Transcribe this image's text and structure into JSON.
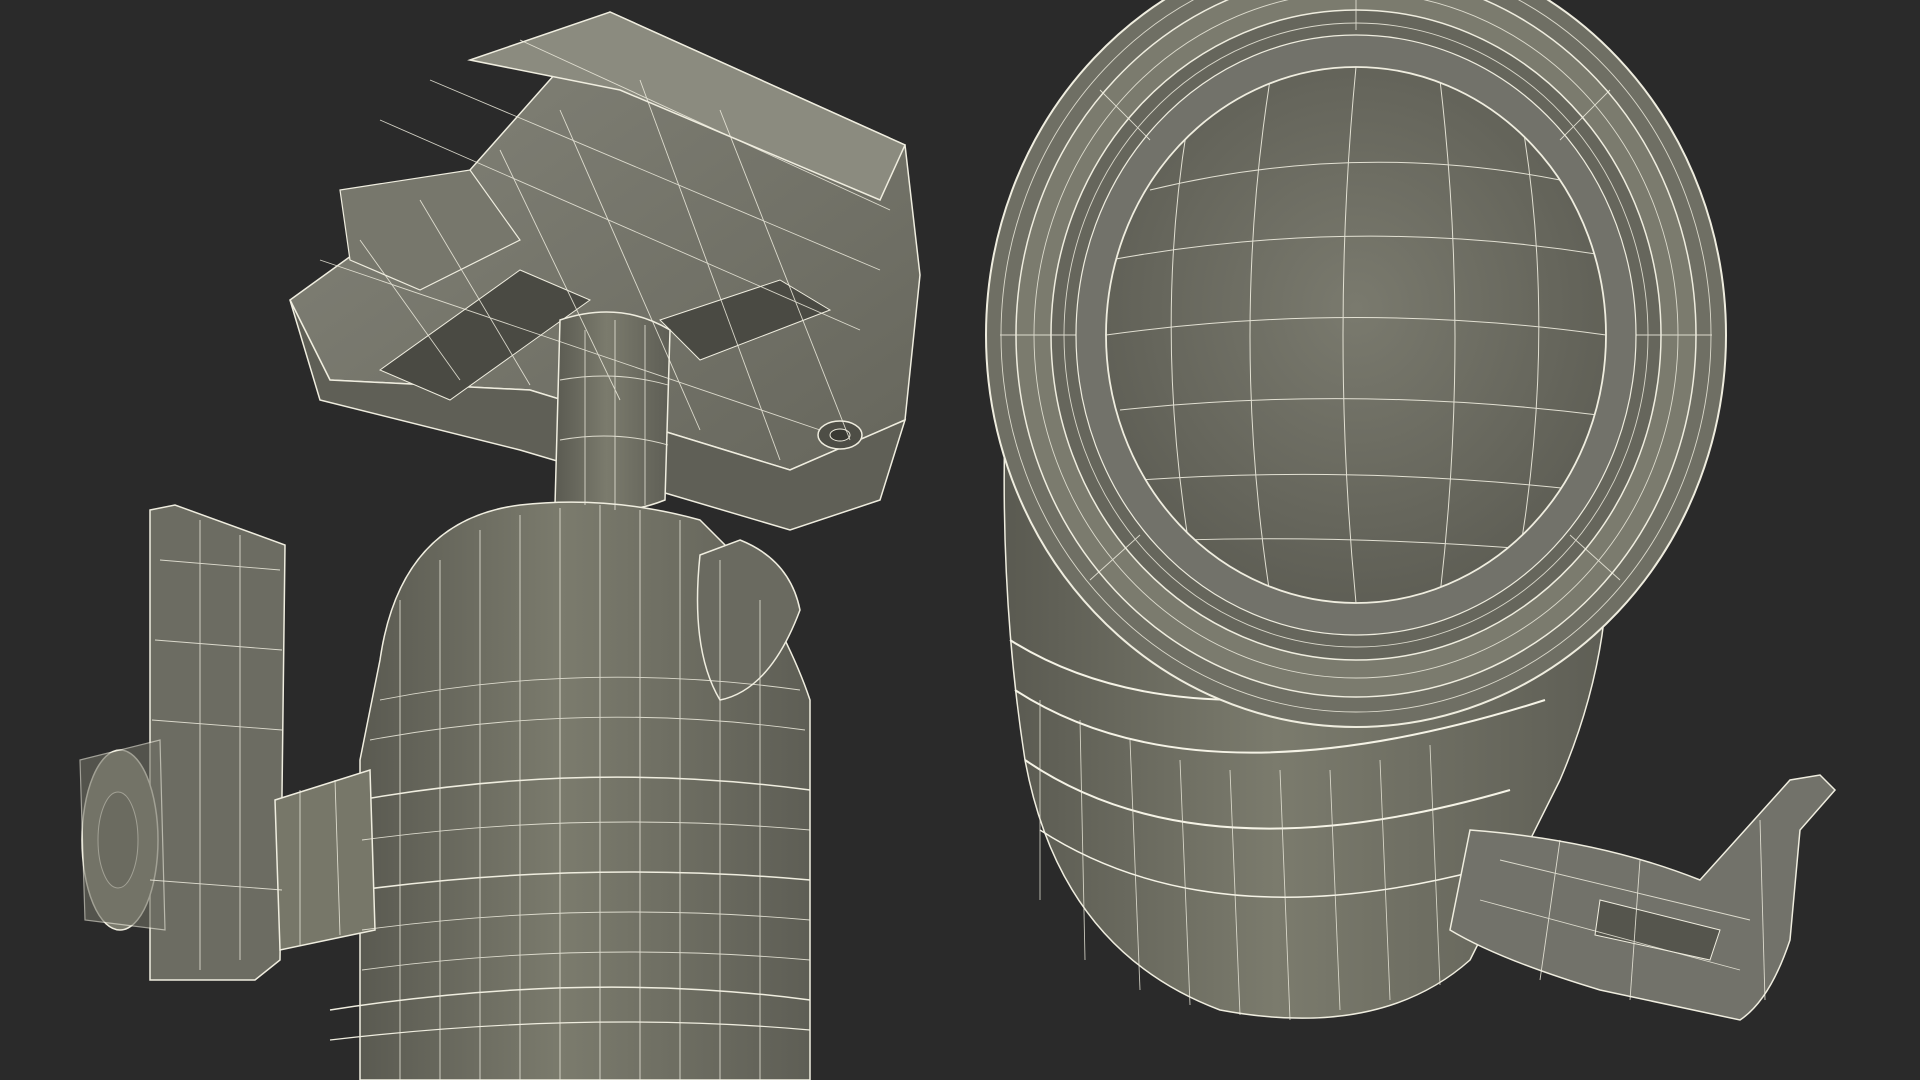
{
  "scene": {
    "description_type": "wireframe-render",
    "background_color": "#2a2a2a",
    "mesh_fill_color": "#6f6f64",
    "mesh_shade_color": "#585850",
    "mesh_light_color": "#8a8a7c",
    "wire_color": "#f2f0e4",
    "objects": [
      {
        "name": "ball-head-tripod-mount",
        "icon": "ball-head-icon"
      },
      {
        "name": "camera-lens",
        "icon": "lens-icon"
      }
    ]
  }
}
